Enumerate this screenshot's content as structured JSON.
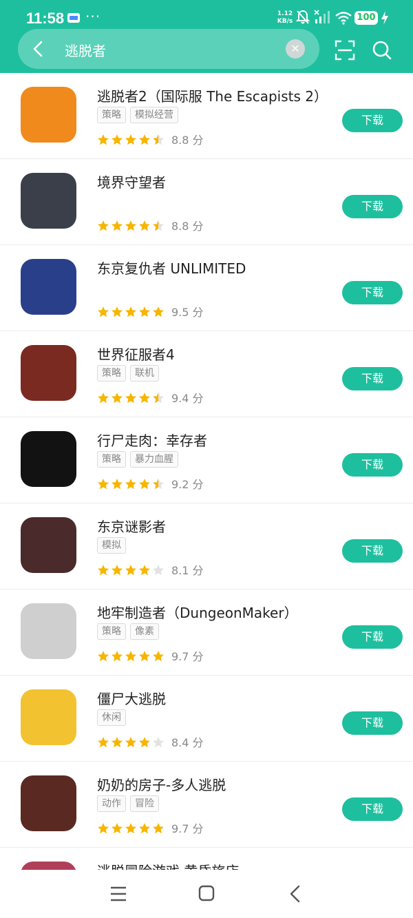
{
  "status_bar": {
    "time": "11:58",
    "more": "···",
    "net_speed_value": "1.12",
    "net_speed_unit": "KB/s",
    "battery": "100"
  },
  "search": {
    "query": "逃脱者",
    "placeholder": ""
  },
  "apps": [
    {
      "title": "逃脱者2（国际服 The Escapists 2）",
      "tags": [
        "策略",
        "模拟经营"
      ],
      "stars": 4.5,
      "score": "8.8 分",
      "button": "下载",
      "icon_bg": "#f08a1c"
    },
    {
      "title": "境界守望者",
      "tags": [],
      "stars": 4.5,
      "score": "8.8 分",
      "button": "下载",
      "icon_bg": "#3a3f4a"
    },
    {
      "title": "东京复仇者 UNLIMITED",
      "tags": [],
      "stars": 5,
      "score": "9.5 分",
      "button": "下载",
      "icon_bg": "#2a3f8a"
    },
    {
      "title": "世界征服者4",
      "tags": [
        "策略",
        "联机"
      ],
      "stars": 4.5,
      "score": "9.4 分",
      "button": "下载",
      "icon_bg": "#7a2a20"
    },
    {
      "title": "行尸走肉：幸存者",
      "tags": [
        "策略",
        "暴力血腥"
      ],
      "stars": 4.5,
      "score": "9.2 分",
      "button": "下载",
      "icon_bg": "#121212"
    },
    {
      "title": "东京谜影者",
      "tags": [
        "模拟"
      ],
      "stars": 4,
      "score": "8.1 分",
      "button": "下载",
      "icon_bg": "#4a2a2a"
    },
    {
      "title": "地牢制造者（DungeonMaker）",
      "tags": [
        "策略",
        "像素"
      ],
      "stars": 5,
      "score": "9.7 分",
      "button": "下载",
      "icon_bg": "#cfcfcf"
    },
    {
      "title": "僵尸大逃脱",
      "tags": [
        "休闲"
      ],
      "stars": 4,
      "score": "8.4 分",
      "button": "下载",
      "icon_bg": "#f2c230"
    },
    {
      "title": "奶奶的房子-多人逃脱",
      "tags": [
        "动作",
        "冒险"
      ],
      "stars": 5,
      "score": "9.7 分",
      "button": "下载",
      "icon_bg": "#5a2a22"
    },
    {
      "title": "逃脱冒险游戏 黄昏旅店",
      "tags": [],
      "stars": 0,
      "score": "",
      "button": "",
      "icon_bg": "#b0405a"
    }
  ],
  "colors": {
    "accent": "#1ebf9e",
    "star_filled": "#f7b500",
    "star_empty": "#e2e2e2"
  },
  "icons": {
    "back": "chevron-left-icon",
    "clear": "close-circle-icon",
    "scan": "scan-icon",
    "search": "search-icon",
    "nav_menu": "menu-icon",
    "nav_home": "home-square-icon",
    "nav_back": "back-arrow-icon"
  }
}
